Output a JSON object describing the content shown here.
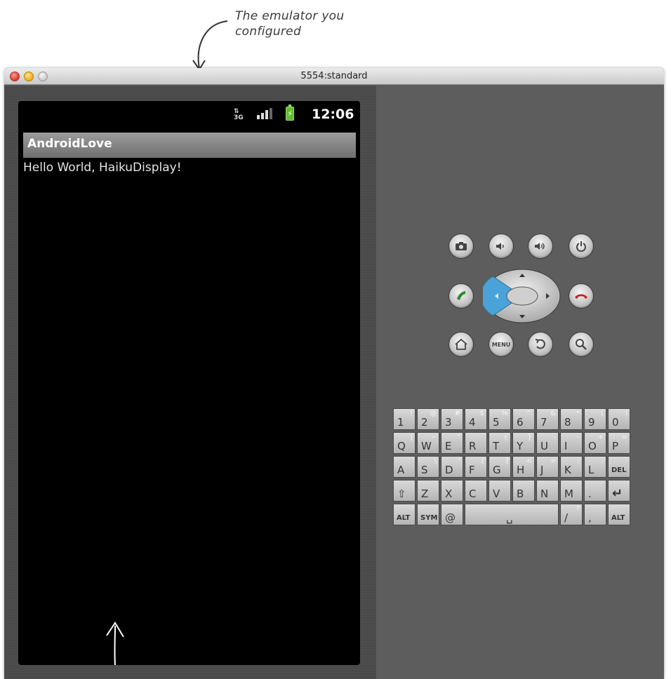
{
  "annotation": {
    "line1": "The emulator you",
    "line2": "configured"
  },
  "window": {
    "title": "5554:standard"
  },
  "status_bar": {
    "network": "3G",
    "time": "12:06",
    "icons": [
      "network-3g-icon",
      "signal-strength-icon",
      "battery-charging-icon"
    ]
  },
  "app": {
    "title": "AndroidLove",
    "message": "Hello World, HaikuDisplay!"
  },
  "hardware_buttons": {
    "row1": [
      "camera-icon",
      "volume-down-icon",
      "volume-up-icon",
      "power-icon"
    ],
    "row2": [
      "call-icon",
      "dpad",
      "end-call-icon"
    ],
    "row3": [
      "home-icon",
      "menu-button",
      "back-icon",
      "search-icon"
    ],
    "menu_label": "MENU"
  },
  "keyboard": {
    "rows": [
      [
        [
          "1",
          "!"
        ],
        [
          "2",
          "@"
        ],
        [
          "3",
          "#"
        ],
        [
          "4",
          "$"
        ],
        [
          "5",
          "%"
        ],
        [
          "6",
          "^"
        ],
        [
          "7",
          "&"
        ],
        [
          "8",
          "*"
        ],
        [
          "9",
          "("
        ],
        [
          "0",
          ")"
        ]
      ],
      [
        [
          "Q",
          "|"
        ],
        [
          "W",
          "~"
        ],
        [
          "E",
          "\""
        ],
        [
          "R",
          "`"
        ],
        [
          "T",
          "{"
        ],
        [
          "Y",
          "}"
        ],
        [
          "U",
          "-"
        ],
        [
          "I",
          "-"
        ],
        [
          "O",
          "+"
        ],
        [
          "P",
          "="
        ]
      ],
      [
        [
          "A",
          ""
        ],
        [
          "S",
          "\\"
        ],
        [
          "D",
          "'"
        ],
        [
          "F",
          "["
        ],
        [
          "G",
          "]"
        ],
        [
          "H",
          "<"
        ],
        [
          "J",
          ">"
        ],
        [
          "K",
          ";"
        ],
        [
          "L",
          ":"
        ],
        [
          "DEL",
          ""
        ]
      ],
      [
        [
          "⇧",
          ""
        ],
        [
          "Z",
          ""
        ],
        [
          "X",
          ""
        ],
        [
          "C",
          ""
        ],
        [
          "V",
          ""
        ],
        [
          "B",
          ""
        ],
        [
          "N",
          ""
        ],
        [
          "M",
          ""
        ],
        [
          ".",
          ""
        ],
        [
          "↵",
          ""
        ]
      ],
      [
        [
          "ALT",
          ""
        ],
        [
          "SYM",
          ""
        ],
        [
          "@",
          ""
        ],
        [
          "␣",
          ""
        ],
        [
          "/",
          "?"
        ],
        [
          ",",
          ""
        ],
        [
          "ALT",
          ""
        ]
      ]
    ]
  },
  "colors": {
    "device_pane": "#4a4a4a",
    "controls_pane": "#5d5d5d",
    "dpad_accent": "#4aa3d8",
    "call_green": "#2f8a2f",
    "end_red": "#c82020"
  }
}
